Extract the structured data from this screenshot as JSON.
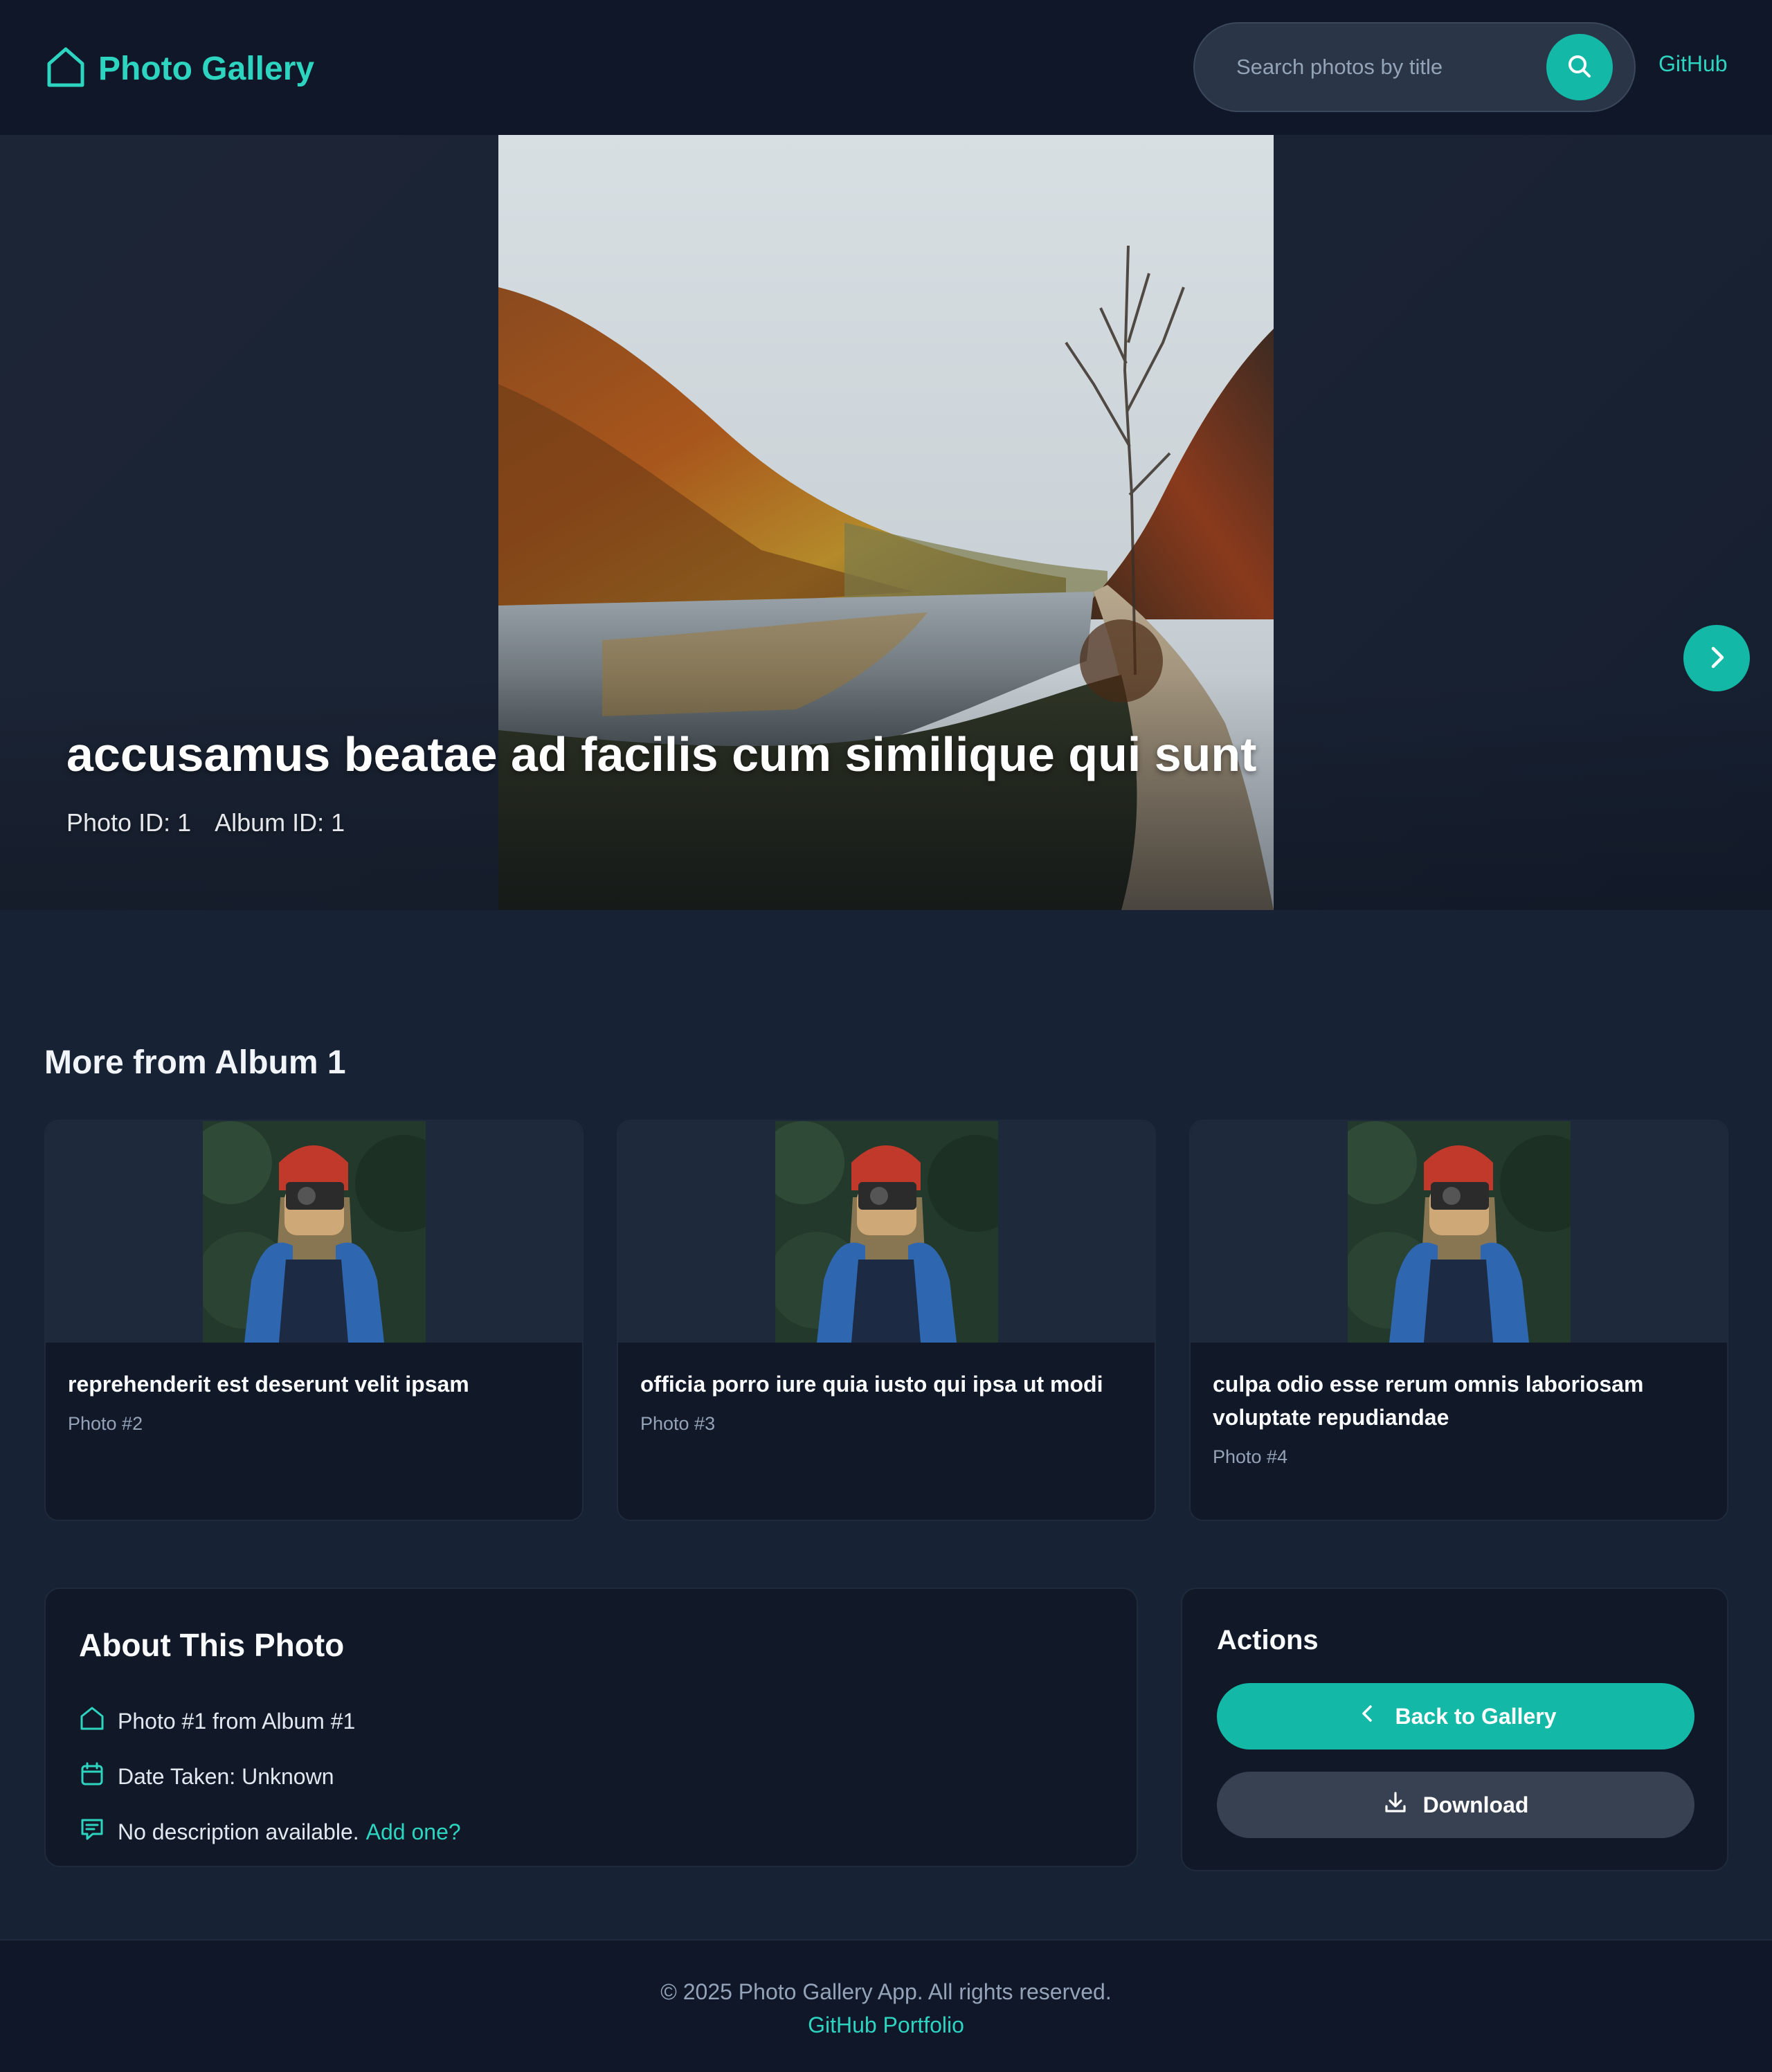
{
  "header": {
    "brand": "Photo Gallery",
    "search_placeholder": "Search photos by title",
    "github": "GitHub"
  },
  "hero": {
    "title": "accusamus beatae ad facilis cum similique qui sunt",
    "photo_id": "Photo ID: 1",
    "album_id": "Album ID: 1"
  },
  "more": {
    "heading": "More from Album 1",
    "cards": [
      {
        "title": "reprehenderit est deserunt velit ipsam",
        "subtitle": "Photo #2"
      },
      {
        "title": "officia porro iure quia iusto qui ipsa ut modi",
        "subtitle": "Photo #3"
      },
      {
        "title": "culpa odio esse rerum omnis laboriosam voluptate repudiandae",
        "subtitle": "Photo #4"
      }
    ]
  },
  "about": {
    "heading": "About This Photo",
    "source": "Photo #1 from Album #1",
    "date": "Date Taken: Unknown",
    "description": "No description available.",
    "add_link": "Add one?"
  },
  "actions": {
    "heading": "Actions",
    "back": "Back to Gallery",
    "download": "Download"
  },
  "footer": {
    "copyright": "© 2025 Photo Gallery App. All rights reserved.",
    "link": "GitHub Portfolio"
  },
  "colors": {
    "accent": "#14b8a6",
    "accent_text": "#2dd4bf",
    "page_bg": "#182235",
    "header_bg": "#0f1729",
    "card_bg": "#111827"
  },
  "icons": {
    "brand": "home-icon",
    "search": "search-icon",
    "next": "chevron-right-icon",
    "back": "chevron-left-icon",
    "download": "download-icon",
    "source": "home-icon",
    "date": "calendar-icon",
    "description": "comment-icon"
  }
}
